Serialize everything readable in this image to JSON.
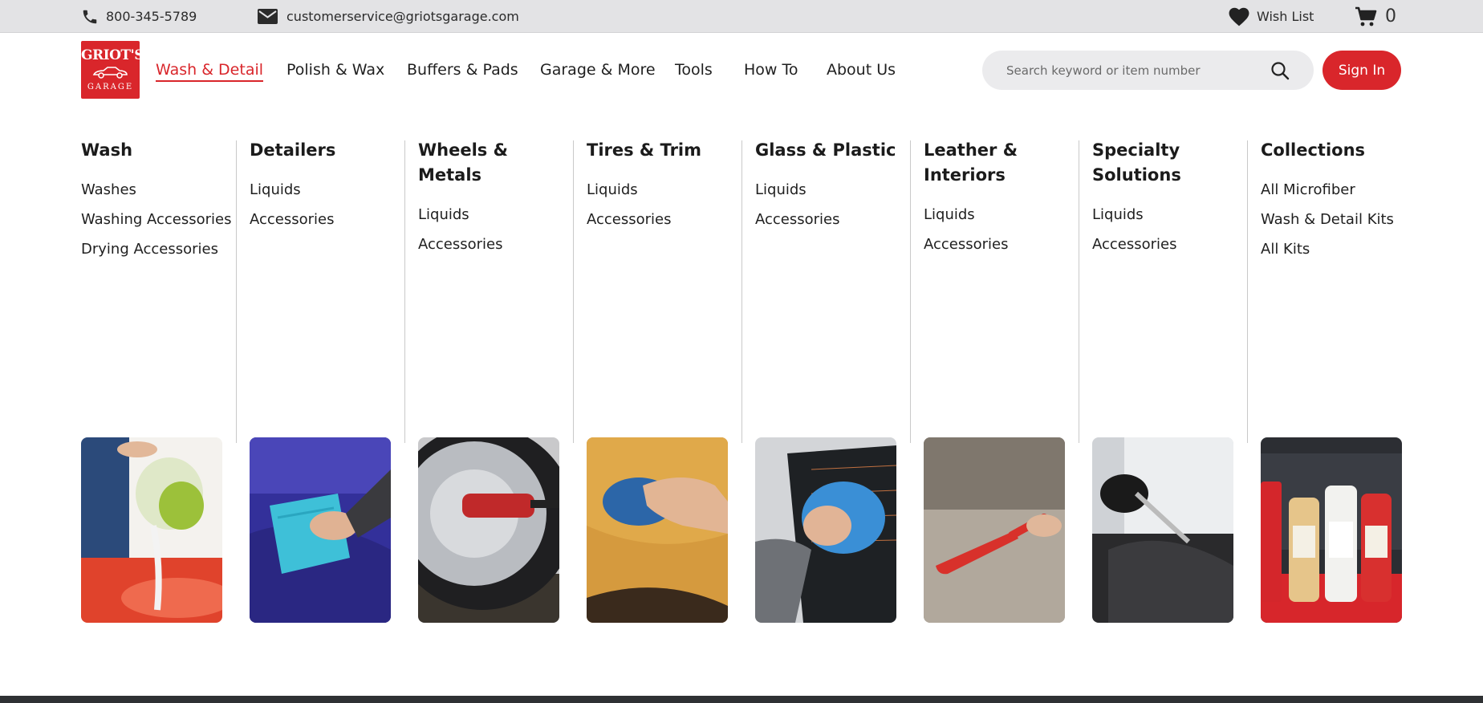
{
  "topbar": {
    "phone": "800-345-5789",
    "email": "customerservice@griotsgarage.com",
    "wishlist": "Wish List",
    "cart_count": "0"
  },
  "logo": {
    "top": "GRIOT'S",
    "bottom": "GARAGE"
  },
  "nav": [
    {
      "label": "Wash & Detail",
      "active": true
    },
    {
      "label": "Polish & Wax"
    },
    {
      "label": "Buffers & Pads"
    },
    {
      "label": "Garage & More"
    },
    {
      "label": "Tools"
    },
    {
      "label": "How To"
    },
    {
      "label": "About Us"
    }
  ],
  "search": {
    "placeholder": "Search keyword or item number"
  },
  "signin": "Sign In",
  "columns": [
    {
      "title": "Wash",
      "items": [
        "Washes",
        "Washing Accessories",
        "Drying Accessories"
      ]
    },
    {
      "title": "Detailers",
      "items": [
        "Liquids",
        "Accessories"
      ]
    },
    {
      "title": "Wheels & Metals",
      "items": [
        "Liquids",
        "Accessories"
      ]
    },
    {
      "title": "Tires & Trim",
      "items": [
        "Liquids",
        "Accessories"
      ]
    },
    {
      "title": "Glass & Plastic",
      "items": [
        "Liquids",
        "Accessories"
      ]
    },
    {
      "title": "Leather & Interiors",
      "items": [
        "Liquids",
        "Accessories"
      ]
    },
    {
      "title": "Specialty Solutions",
      "items": [
        "Liquids",
        "Accessories"
      ]
    },
    {
      "title": "Collections",
      "items": [
        "All Microfiber",
        "Wash & Detail Kits",
        "All Kits"
      ]
    }
  ],
  "colors": {
    "brand_red": "#d9262b",
    "topbar_bg": "#e3e3e5",
    "search_bg": "#ebebed"
  },
  "icons": {
    "phone": "phone-icon",
    "email": "envelope-icon",
    "wishlist": "heart-icon",
    "cart": "cart-icon",
    "search": "search-icon"
  }
}
